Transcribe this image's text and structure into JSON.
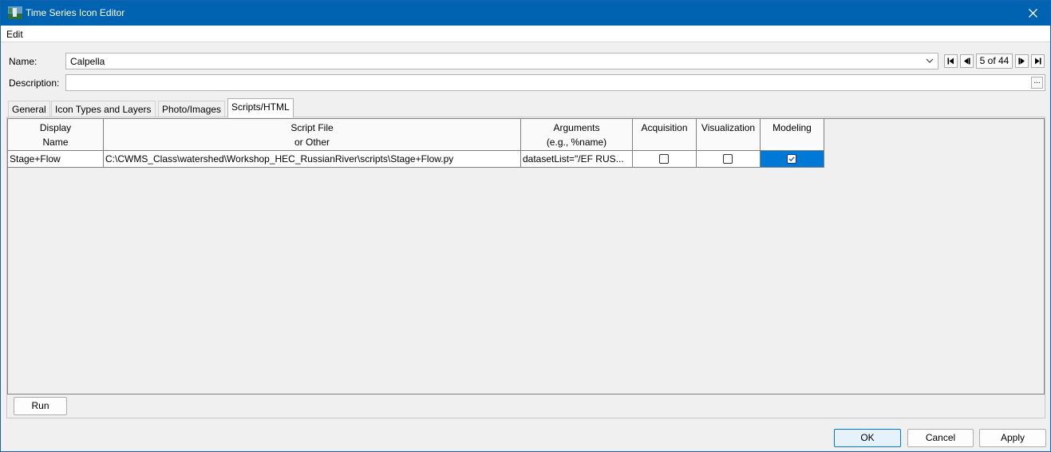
{
  "window": {
    "title": "Time Series Icon Editor"
  },
  "menu": {
    "edit": "Edit"
  },
  "form": {
    "name_label": "Name:",
    "name_value": "Calpella",
    "counter": "5 of 44",
    "description_label": "Description:",
    "description_value": "",
    "ellipsis": "..."
  },
  "tabs": [
    {
      "label": "General"
    },
    {
      "label": "Icon Types and Layers"
    },
    {
      "label": "Photo/Images"
    },
    {
      "label": "Scripts/HTML",
      "active": true
    }
  ],
  "table": {
    "headers": {
      "display": [
        "Display",
        "Name"
      ],
      "script": [
        "Script File",
        "or Other"
      ],
      "args": [
        "Arguments",
        "(e.g., %name)"
      ],
      "acq": "Acquisition",
      "vis": "Visualization",
      "mod": "Modeling"
    },
    "rows": [
      {
        "display_name": "Stage+Flow",
        "script_file": "C:\\CWMS_Class\\watershed\\Workshop_HEC_RussianRiver\\scripts\\Stage+Flow.py",
        "arguments": "datasetList=\"/EF RUS...",
        "acquisition": false,
        "visualization": false,
        "modeling": true
      }
    ]
  },
  "buttons": {
    "run": "Run",
    "ok": "OK",
    "cancel": "Cancel",
    "apply": "Apply"
  },
  "icons": {
    "app": "waterfall-app-icon",
    "close": "close-icon",
    "dropdown": "chevron-down-icon"
  },
  "colors": {
    "titlebar": "#0063b1",
    "selection": "#0078d7"
  }
}
